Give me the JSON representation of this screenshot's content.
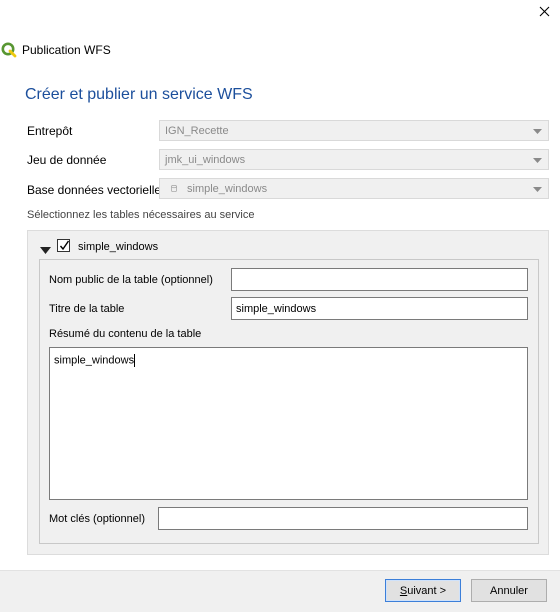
{
  "window": {
    "title": "Publication WFS",
    "heading": "Créer et publier un service WFS"
  },
  "form": {
    "entrepot_label": "Entrepôt",
    "entrepot_value": "IGN_Recette",
    "jeu_label": "Jeu de donnée",
    "jeu_value": "jmk_ui_windows",
    "base_label": "Base données vectorielle",
    "base_value": "simple_windows",
    "tables_hint": "Sélectionnez les tables nécessaires au service"
  },
  "layer": {
    "name": "simple_windows",
    "checked": true,
    "nom_public_label": "Nom public de la table (optionnel)",
    "nom_public_value": "",
    "titre_label": "Titre de la table",
    "titre_value": "simple_windows",
    "resume_label": "Résumé du contenu de la table",
    "resume_value": "simple_windows",
    "mots_cles_label": "Mot clés (optionnel)",
    "mots_cles_value": ""
  },
  "buttons": {
    "next_mnemonic": "S",
    "next_rest": "uivant >",
    "cancel": "Annuler"
  },
  "colors": {
    "heading": "#1c4f9c",
    "panel_bg": "#f0f0f0",
    "primary_border": "#3c7fd9",
    "logo_green": "#589632"
  }
}
